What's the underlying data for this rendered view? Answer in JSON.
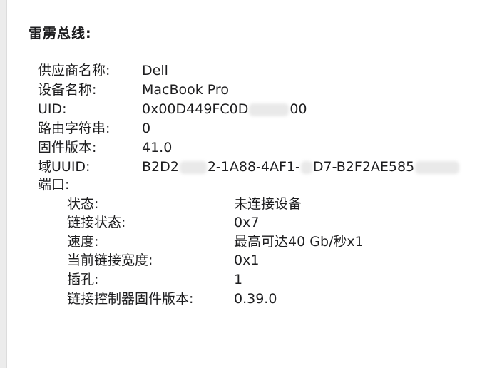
{
  "section": {
    "title": "雷雳总线:"
  },
  "info": {
    "vendor_label": "供应商名称:",
    "vendor_value": "Dell",
    "device_label": "设备名称:",
    "device_value": "MacBook Pro",
    "uid_label": "UID:",
    "uid_value_a": "0x00D449FC0D",
    "uid_value_b": "00",
    "route_label": "路由字符串:",
    "route_value": "0",
    "firmware_label": "固件版本:",
    "firmware_value": "41.0",
    "domain_uuid_label": "域UUID:",
    "domain_uuid_a": "B2D2",
    "domain_uuid_b": "2-1A88-4AF1-",
    "domain_uuid_c": "D7-B2F2AE585",
    "port_label": "端口:"
  },
  "port": {
    "status_label": "状态:",
    "status_value": "未连接设备",
    "link_status_label": "链接状态:",
    "link_status_value": "0x7",
    "speed_label": "速度:",
    "speed_value": "最高可达40 Gb/秒x1",
    "link_width_label": "当前链接宽度:",
    "link_width_value": "0x1",
    "socket_label": "插孔:",
    "socket_value": "1",
    "controller_fw_label": "链接控制器固件版本:",
    "controller_fw_value": "0.39.0"
  }
}
